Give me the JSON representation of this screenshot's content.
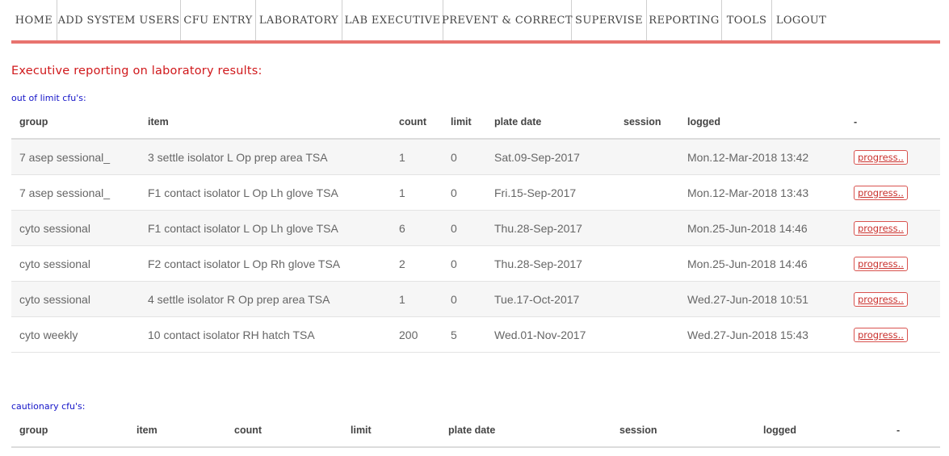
{
  "nav": {
    "items": [
      "HOME",
      "ADD SYSTEM USERS",
      "CFU ENTRY",
      "LABORATORY",
      "LAB EXECUTIVE",
      "PREVENT & CORRECT",
      "SUPERVISE",
      "REPORTING",
      "TOOLS",
      "LOGOUT"
    ]
  },
  "page": {
    "title": "Executive reporting on laboratory results:"
  },
  "out_of_limit": {
    "label": "out of limit cfu's:",
    "columns": [
      "group",
      "item",
      "count",
      "limit",
      "plate date",
      "session",
      "logged",
      "-"
    ],
    "rows": [
      {
        "group": "7 asep sessional_",
        "item": "3 settle isolator L Op prep area TSA",
        "count": "1",
        "limit": "0",
        "plate_date": "Sat.09-Sep-2017",
        "session": "",
        "logged": "Mon.12-Mar-2018 13:42",
        "action": "progress.."
      },
      {
        "group": "7 asep sessional_",
        "item": "F1 contact isolator L Op Lh glove TSA",
        "count": "1",
        "limit": "0",
        "plate_date": "Fri.15-Sep-2017",
        "session": "",
        "logged": "Mon.12-Mar-2018 13:43",
        "action": "progress.."
      },
      {
        "group": "cyto sessional",
        "item": "F1 contact isolator L Op Lh glove TSA",
        "count": "6",
        "limit": "0",
        "plate_date": "Thu.28-Sep-2017",
        "session": "",
        "logged": "Mon.25-Jun-2018 14:46",
        "action": "progress.."
      },
      {
        "group": "cyto sessional",
        "item": "F2 contact isolator L Op Rh glove TSA",
        "count": "2",
        "limit": "0",
        "plate_date": "Thu.28-Sep-2017",
        "session": "",
        "logged": "Mon.25-Jun-2018 14:46",
        "action": "progress.."
      },
      {
        "group": "cyto sessional",
        "item": "4 settle isolator R Op prep area TSA",
        "count": "1",
        "limit": "0",
        "plate_date": "Tue.17-Oct-2017",
        "session": "",
        "logged": "Wed.27-Jun-2018 10:51",
        "action": "progress.."
      },
      {
        "group": "cyto weekly",
        "item": "10 contact isolator RH hatch TSA",
        "count": "200",
        "limit": "5",
        "plate_date": "Wed.01-Nov-2017",
        "session": "",
        "logged": "Wed.27-Jun-2018 15:43",
        "action": "progress.."
      }
    ]
  },
  "cautionary": {
    "label": "cautionary cfu's:",
    "columns": [
      "group",
      "item",
      "count",
      "limit",
      "plate date",
      "session",
      "logged",
      "-"
    ],
    "rows": []
  },
  "colors": {
    "accent_bar": "#e8736f",
    "title_red": "#d0181b",
    "label_blue": "#1414c8",
    "button_red": "#d9534f"
  }
}
